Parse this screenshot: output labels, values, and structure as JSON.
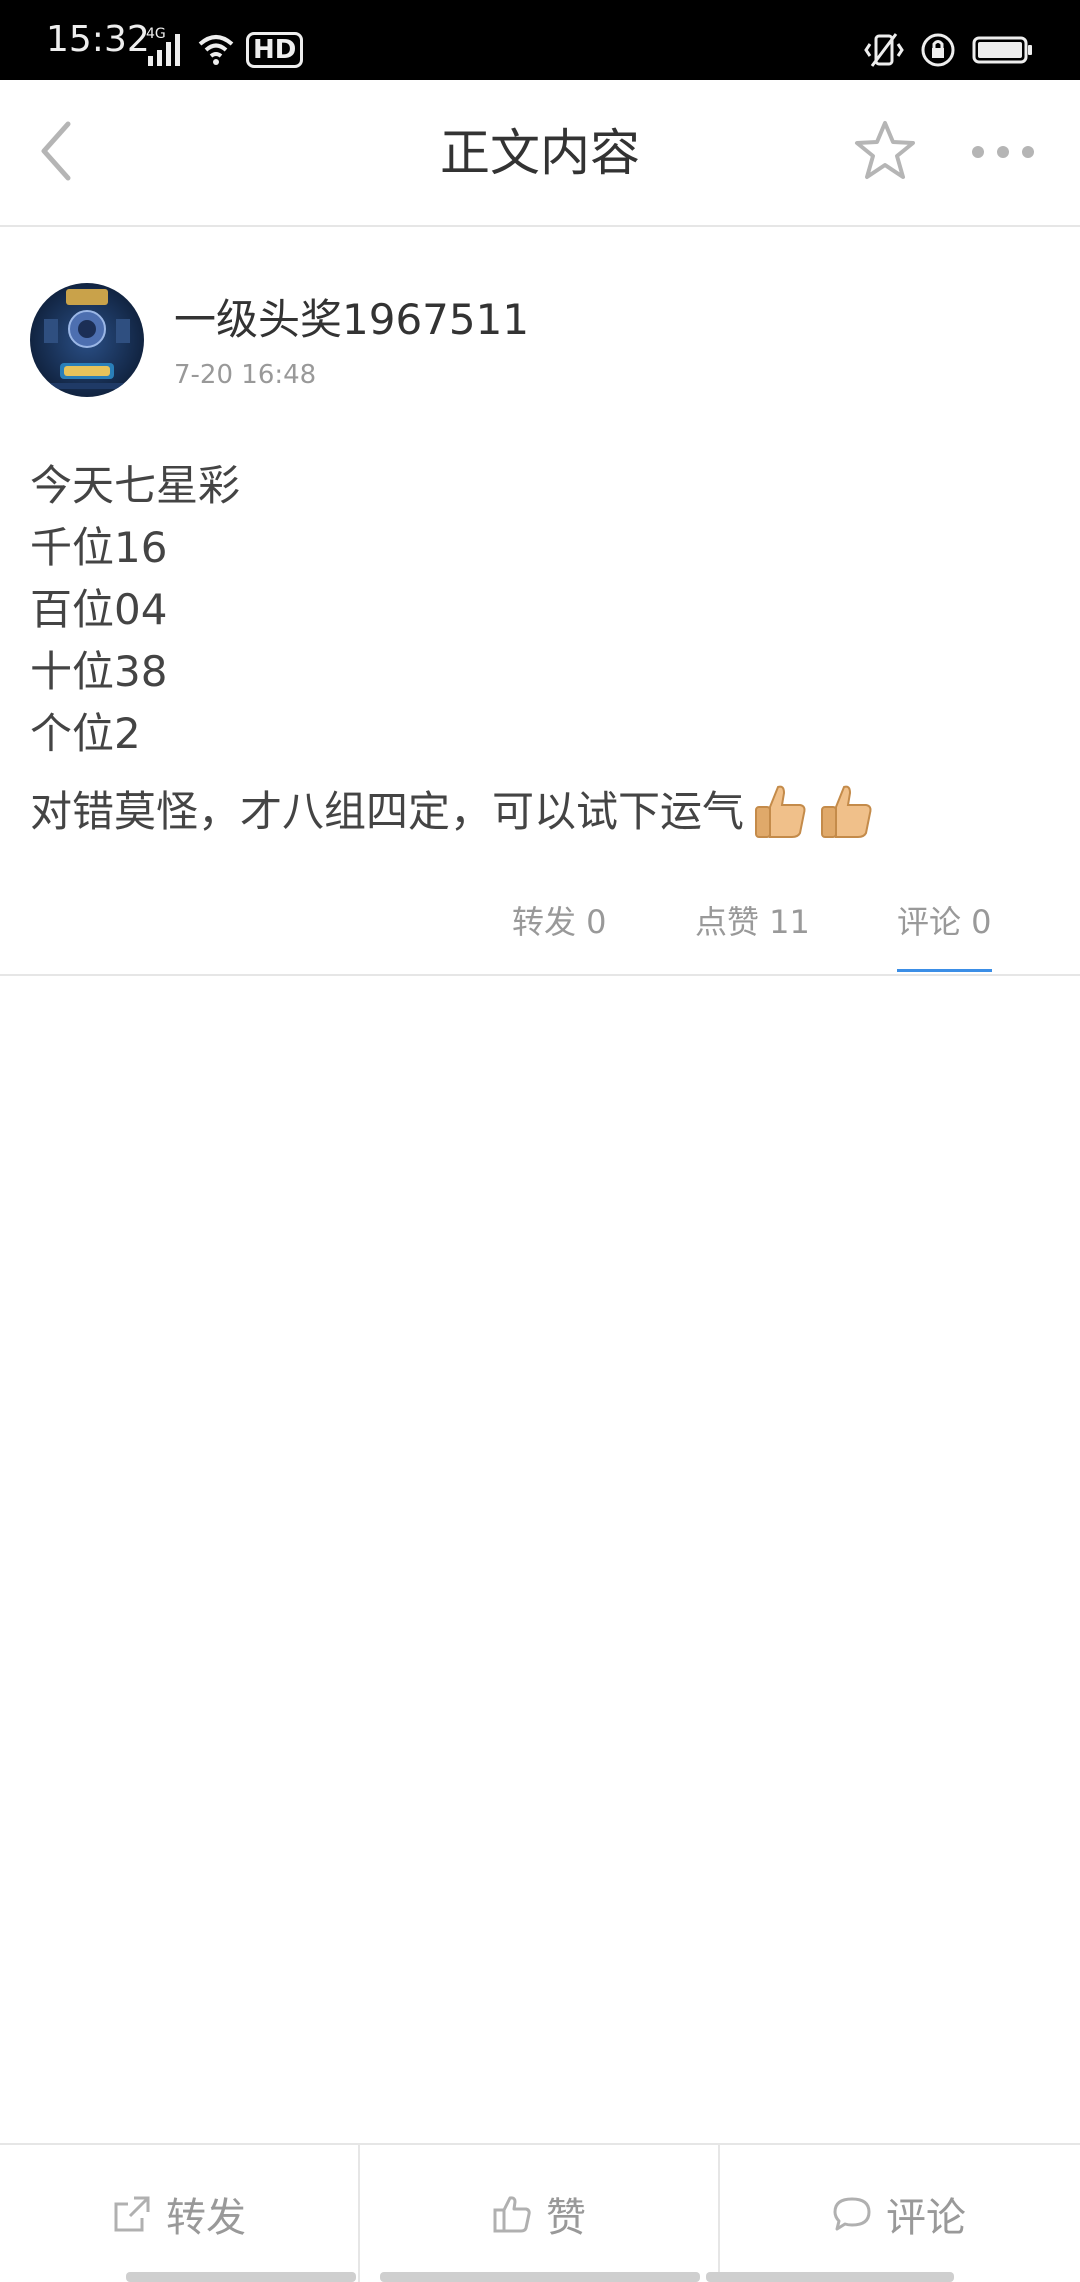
{
  "status_bar": {
    "time": "15:32",
    "network": "4G",
    "hd_label": "HD",
    "icons": [
      "signal-icon",
      "wifi-icon",
      "hd-icon",
      "vibrate-icon",
      "lock-rotation-icon",
      "battery-icon"
    ]
  },
  "header": {
    "title": "正文内容",
    "back_icon": "chevron-left-icon",
    "favorite_icon": "star-icon",
    "more_icon": "more-icon"
  },
  "post": {
    "author": "一级头奖1967511",
    "time": "7-20 16:48",
    "lines": [
      "今天七星彩",
      "千位16",
      "百位04",
      "十位38",
      "个位2"
    ],
    "last_line": "对错莫怪，才八组四定，可以试下运气",
    "emoji": [
      "thumbs-up-icon",
      "thumbs-up-icon"
    ]
  },
  "stats": {
    "repost": "转发 0",
    "likes": "点赞 11",
    "comments": "评论 0",
    "active_tab": "comments"
  },
  "bottom_bar": {
    "repost": "转发",
    "like": "赞",
    "comment": "评论"
  },
  "colors": {
    "accent": "#3b8ee6",
    "text": "#333333",
    "muted": "#999999",
    "divider": "#e6e6e6"
  }
}
